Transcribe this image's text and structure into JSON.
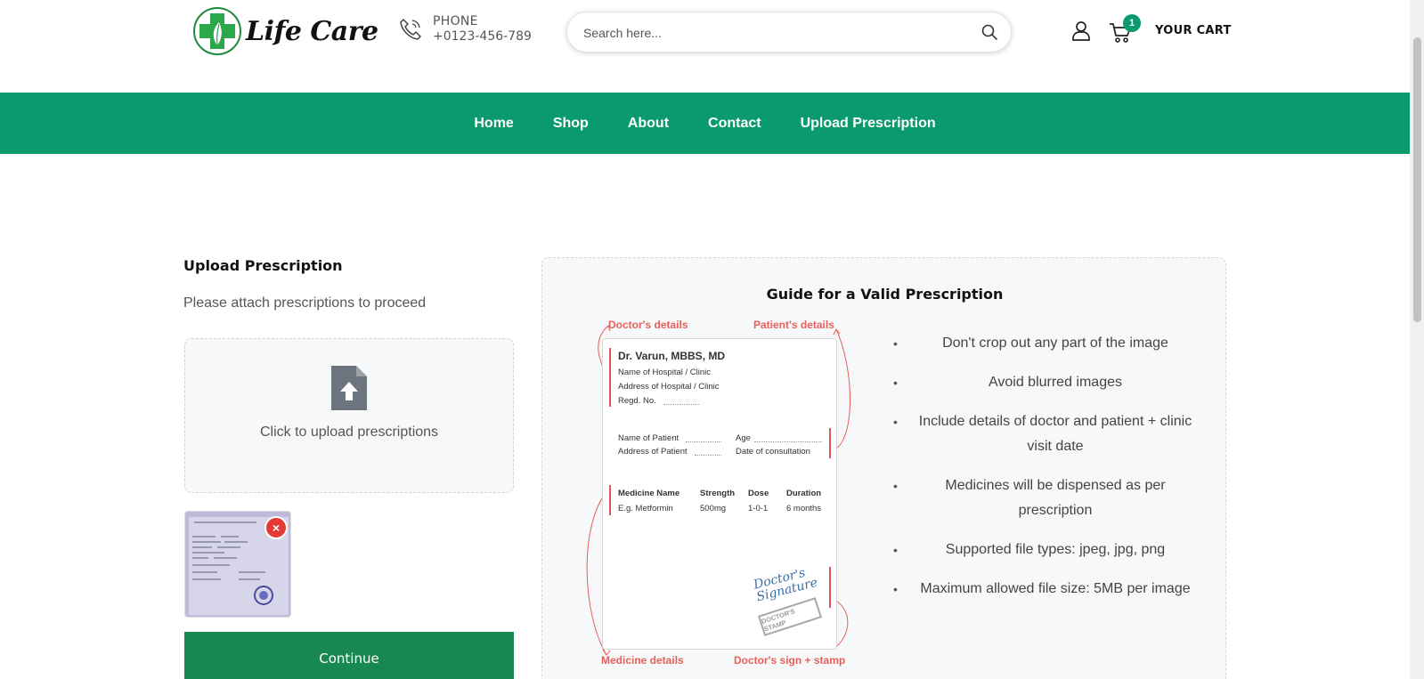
{
  "header": {
    "logo_text": "Life Care",
    "phone_label": "PHONE",
    "phone_number": "+0123-456-789",
    "search_placeholder": "Search here...",
    "cart_count": "1",
    "cart_label": "YOUR CART"
  },
  "nav": {
    "items": [
      "Home",
      "Shop",
      "About",
      "Contact",
      "Upload Prescription"
    ]
  },
  "upload": {
    "title": "Upload Prescription",
    "subtitle": "Please attach prescriptions to proceed",
    "box_text": "Click to upload prescriptions",
    "remove_symbol": "×",
    "continue_label": "Continue"
  },
  "guide": {
    "title": "Guide for a Valid Prescription",
    "annotations": {
      "doctor": "Doctor's details",
      "patient": "Patient's details",
      "medicine": "Medicine details",
      "sign": "Doctor's sign + stamp"
    },
    "sample": {
      "doctor_name": "Dr. Varun, MBBS, MD",
      "hospital": "Name of Hospital / Clinic",
      "address": "Address of Hospital / Clinic",
      "regd": "Regd. No.",
      "patient_name": "Name of Patient",
      "patient_address": "Address of Patient",
      "age": "Age",
      "date": "Date of consultation",
      "col_medicine": "Medicine Name",
      "col_strength": "Strength",
      "col_dose": "Dose",
      "col_duration": "Duration",
      "med_name": "E.g. Metformin",
      "med_strength": "500mg",
      "med_dose": "1-0-1",
      "med_duration": "6 months",
      "signature": "Doctor's Signature",
      "stamp": "DOCTOR'S STAMP"
    },
    "rules": [
      "Don't crop out any part of the image",
      "Avoid blurred images",
      "Include details of doctor and patient + clinic visit date",
      "Medicines will be dispensed as per prescription",
      "Supported file types: jpeg, jpg, png",
      "Maximum allowed file size: 5MB per image"
    ]
  },
  "colors": {
    "brand_green": "#0b9a6d",
    "continue_green": "#17884f",
    "annotation_red": "#e8605a"
  }
}
